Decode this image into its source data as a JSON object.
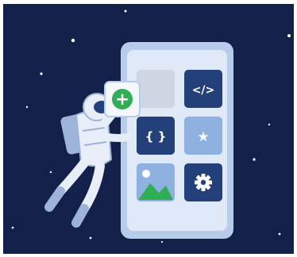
{
  "scene": {
    "background_color": "#13204a",
    "phone_color": "#dfe9f7",
    "phone_border": "#b7cbea",
    "tile_dark": "#24407a",
    "tile_light": "#8fb1df",
    "tile_grey": "#cdd6e2",
    "accent_green": "#2fae55"
  },
  "tiles": {
    "code": {
      "icon": "code-brackets-icon",
      "glyph": "</>"
    },
    "braces": {
      "icon": "curly-braces-icon",
      "glyph": "{ }"
    },
    "star": {
      "icon": "star-icon",
      "glyph": "★"
    },
    "image": {
      "icon": "image-landscape-icon"
    },
    "settings": {
      "icon": "gear-icon"
    },
    "empty": {
      "icon": "empty-slot"
    }
  },
  "add_badge": {
    "icon": "plus-icon",
    "glyph": "+"
  },
  "astronaut": {
    "icon": "astronaut-illustration"
  }
}
